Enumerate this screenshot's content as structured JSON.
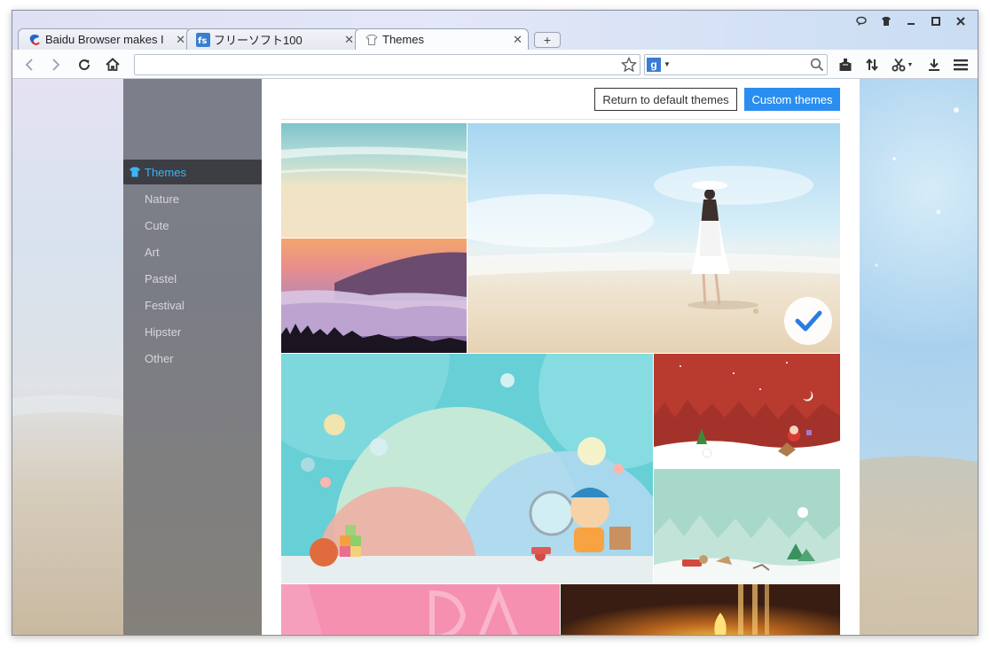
{
  "window": {
    "controls": [
      "feedback",
      "skin",
      "minimize",
      "maximize",
      "close"
    ]
  },
  "tabs": [
    {
      "title": "Baidu Browser makes I",
      "icon": "baidu-icon",
      "active": false
    },
    {
      "title": "フリーソフト100",
      "icon": "fs-icon",
      "active": false
    },
    {
      "title": "Themes",
      "icon": "shirt-icon",
      "active": true
    }
  ],
  "new_tab_label": "+",
  "toolbar": {
    "address_value": "",
    "search_value": "",
    "search_engine_badge": "g"
  },
  "sidebar": {
    "items": [
      {
        "label": "Themes",
        "active": true
      },
      {
        "label": "Nature",
        "active": false
      },
      {
        "label": "Cute",
        "active": false
      },
      {
        "label": "Art",
        "active": false
      },
      {
        "label": "Pastel",
        "active": false
      },
      {
        "label": "Festival",
        "active": false
      },
      {
        "label": "Hipster",
        "active": false
      },
      {
        "label": "Other",
        "active": false
      }
    ]
  },
  "main": {
    "return_default_label": "Return to default themes",
    "custom_themes_label": "Custom themes"
  },
  "colors": {
    "accent": "#2a8ef0",
    "sidebar_active_text": "#3db4f5",
    "sidebar_active_bg": "#3d3e44"
  }
}
